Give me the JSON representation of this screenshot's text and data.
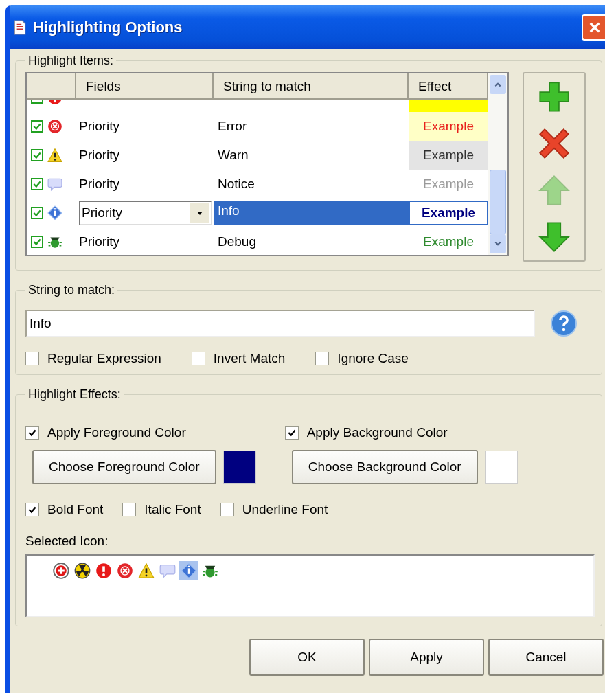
{
  "window": {
    "title": "Highlighting Options"
  },
  "highlight_items": {
    "label": "Highlight Items:",
    "columns": [
      "Fields",
      "String to match",
      "Effect"
    ],
    "rows": [
      {
        "kind": "alert",
        "clipped": true,
        "effect_cell": {
          "color": "#ffff00"
        }
      },
      {
        "kind": "error",
        "clipped": false,
        "checked": true,
        "field": "Priority",
        "match": "Error",
        "effect": {
          "text": "Example",
          "color": "#e8201c",
          "bold": false
        },
        "effect_cell": {
          "color": "#ffffc6"
        },
        "selected": false
      },
      {
        "kind": "warning",
        "clipped": false,
        "checked": true,
        "field": "Priority",
        "match": "Warn",
        "effect": {
          "text": "Example",
          "color": "#303030",
          "bold": false
        },
        "effect_cell": {
          "color": "#e4e4e4"
        },
        "selected": false
      },
      {
        "kind": "notice",
        "clipped": false,
        "checked": true,
        "field": "Priority",
        "match": "Notice",
        "effect": {
          "text": "Example",
          "color": "#9a9a9a",
          "bold": false
        },
        "selected": false
      },
      {
        "kind": "info",
        "clipped": false,
        "checked": true,
        "field": "Priority",
        "match": "Info",
        "effect": {
          "text": "Example",
          "color": "#000080",
          "bold": true
        },
        "selected": true
      },
      {
        "kind": "debug",
        "clipped": false,
        "checked": true,
        "field": "Priority",
        "match": "Debug",
        "effect": {
          "text": "Example",
          "color": "#2e8a2e",
          "bold": false
        },
        "selected": false
      }
    ],
    "tools": [
      {
        "kind": "add",
        "disabled": false
      },
      {
        "kind": "delete",
        "disabled": false
      },
      {
        "kind": "up",
        "disabled": true
      },
      {
        "kind": "down",
        "disabled": false
      }
    ]
  },
  "string_to_match": {
    "label": "String to match:",
    "value": "Info",
    "options": [
      {
        "label": "Regular Expression",
        "checked": false
      },
      {
        "label": "Invert Match",
        "checked": false
      },
      {
        "label": "Ignore Case",
        "checked": false
      }
    ]
  },
  "highlight_effects": {
    "label": "Highlight Effects:",
    "foreground": {
      "label": "Apply Foreground Color",
      "checked": true,
      "button": "Choose Foreground Color",
      "color": "#000080"
    },
    "background": {
      "label": "Apply Background Color",
      "checked": true,
      "button": "Choose Background Color",
      "color": "#ffffff"
    },
    "font_options": [
      {
        "label": "Bold Font",
        "checked": true
      },
      {
        "label": "Italic Font",
        "checked": false
      },
      {
        "label": "Underline Font",
        "checked": false
      }
    ],
    "icon_label": "Selected Icon:",
    "icons": [
      {
        "kind": "critical",
        "selected": false
      },
      {
        "kind": "radiation",
        "selected": false
      },
      {
        "kind": "alert",
        "selected": false
      },
      {
        "kind": "error",
        "selected": false
      },
      {
        "kind": "warning",
        "selected": false
      },
      {
        "kind": "notice",
        "selected": false
      },
      {
        "kind": "info",
        "selected": true
      },
      {
        "kind": "debug",
        "selected": false
      }
    ]
  },
  "buttons": [
    "OK",
    "Apply",
    "Cancel"
  ]
}
